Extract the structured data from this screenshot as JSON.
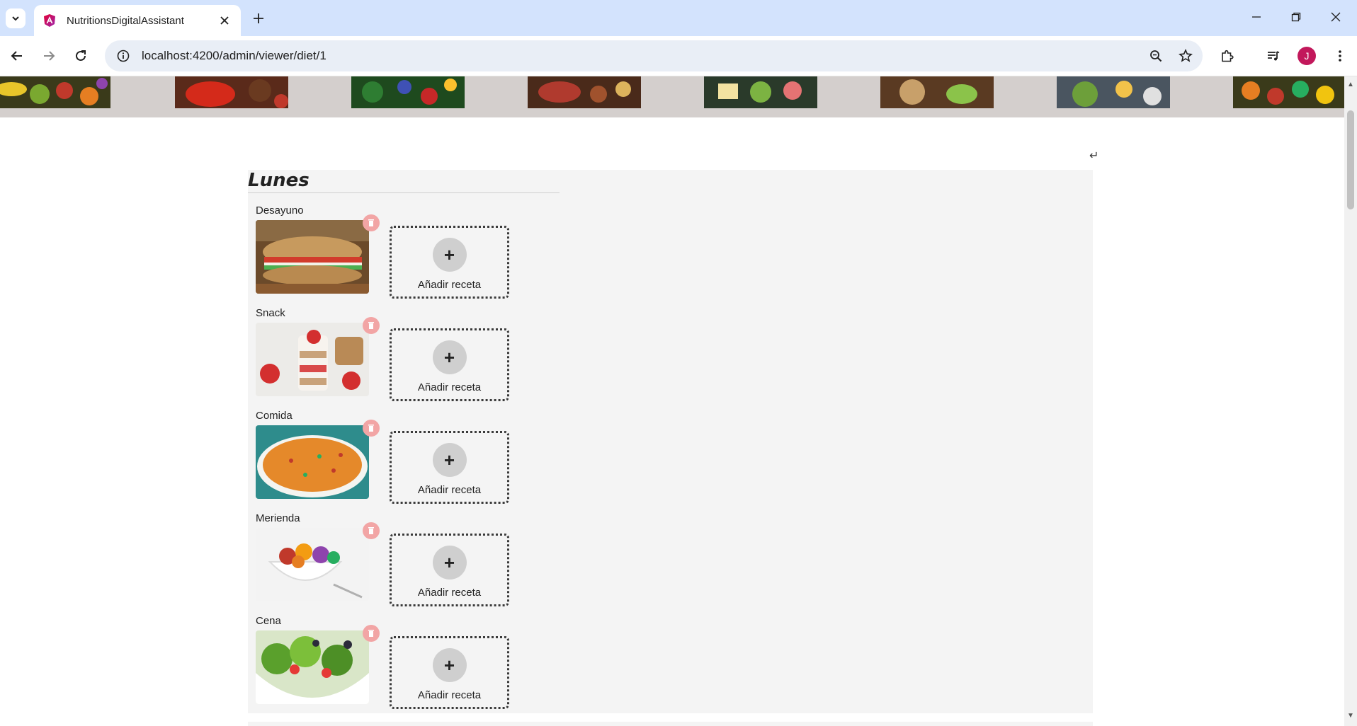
{
  "browser": {
    "tab_title": "NutritionsDigitalAssistant",
    "url": "localhost:4200/admin/viewer/diet/1",
    "profile_initial": "J"
  },
  "page": {
    "return_icon": "↵",
    "day": {
      "title": "Lunes",
      "meals": [
        {
          "label": "Desayuno",
          "image": "sandwich-photo",
          "add_label": "Añadir receta",
          "add_symbol": "+"
        },
        {
          "label": "Snack",
          "image": "yogurt-parfait-photo",
          "add_label": "Añadir receta",
          "add_symbol": "+"
        },
        {
          "label": "Comida",
          "image": "paella-photo",
          "add_label": "Añadir receta",
          "add_symbol": "+"
        },
        {
          "label": "Merienda",
          "image": "fruit-bowl-photo",
          "add_label": "Añadir receta",
          "add_symbol": "+"
        },
        {
          "label": "Cena",
          "image": "salad-photo",
          "add_label": "Añadir receta",
          "add_symbol": "+"
        }
      ]
    }
  },
  "colors": {
    "tabbar": "#d3e3fd",
    "banner": "#d4cfcd",
    "panel": "#f4f4f4",
    "remove": "#f2a5a5",
    "accent": "#c2185b"
  }
}
